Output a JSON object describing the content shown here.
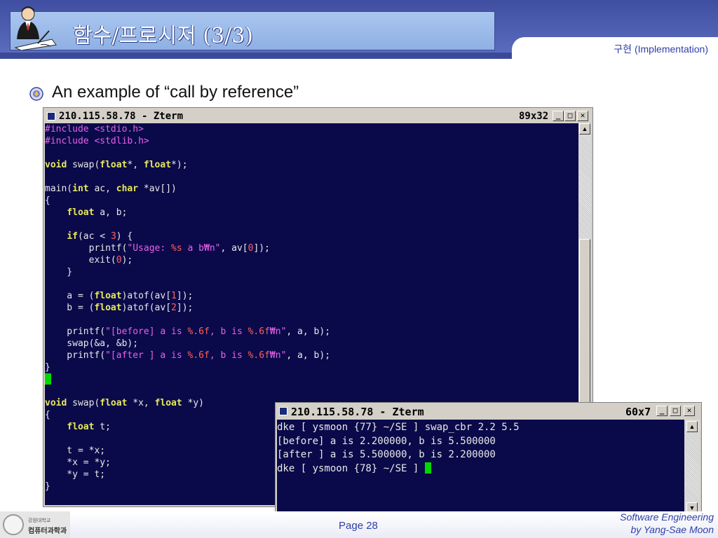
{
  "header": {
    "title": "함수/프로시저 (3/3)",
    "subtitle": "구현 (Implementation)"
  },
  "slide": {
    "bullet": "An example of “call by reference”"
  },
  "window_main": {
    "title": "210.115.58.78 - Zterm",
    "size": "89x32",
    "code_lines": [
      [
        {
          "c": "p",
          "t": "#include "
        },
        {
          "c": "p",
          "t": "<stdio.h>"
        }
      ],
      [
        {
          "c": "p",
          "t": "#include "
        },
        {
          "c": "p",
          "t": "<stdlib.h>"
        }
      ],
      [],
      [
        {
          "c": "k",
          "t": "void"
        },
        {
          "t": " swap("
        },
        {
          "c": "k",
          "t": "float"
        },
        {
          "t": "*, "
        },
        {
          "c": "k",
          "t": "float"
        },
        {
          "t": "*);"
        }
      ],
      [],
      [
        {
          "t": "main("
        },
        {
          "c": "k",
          "t": "int"
        },
        {
          "t": " ac, "
        },
        {
          "c": "k",
          "t": "char"
        },
        {
          "t": " *av[])"
        }
      ],
      [
        {
          "t": "{"
        }
      ],
      [
        {
          "t": "    "
        },
        {
          "c": "k",
          "t": "float"
        },
        {
          "t": " a, b;"
        }
      ],
      [],
      [
        {
          "t": "    "
        },
        {
          "c": "k",
          "t": "if"
        },
        {
          "t": "(ac < "
        },
        {
          "c": "n",
          "t": "3"
        },
        {
          "t": ") {"
        }
      ],
      [
        {
          "t": "        printf("
        },
        {
          "c": "s",
          "t": "\"Usage: "
        },
        {
          "c": "f",
          "t": "%s"
        },
        {
          "c": "s",
          "t": " a b₩n\""
        },
        {
          "t": ", av["
        },
        {
          "c": "n",
          "t": "0"
        },
        {
          "t": "]);"
        }
      ],
      [
        {
          "t": "        exit("
        },
        {
          "c": "n",
          "t": "0"
        },
        {
          "t": ");"
        }
      ],
      [
        {
          "t": "    }"
        }
      ],
      [],
      [
        {
          "t": "    a = ("
        },
        {
          "c": "k",
          "t": "float"
        },
        {
          "t": ")atof(av["
        },
        {
          "c": "n",
          "t": "1"
        },
        {
          "t": "]);"
        }
      ],
      [
        {
          "t": "    b = ("
        },
        {
          "c": "k",
          "t": "float"
        },
        {
          "t": ")atof(av["
        },
        {
          "c": "n",
          "t": "2"
        },
        {
          "t": "]);"
        }
      ],
      [],
      [
        {
          "t": "    printf("
        },
        {
          "c": "s",
          "t": "\"[before] a is "
        },
        {
          "c": "f",
          "t": "%.6f"
        },
        {
          "c": "s",
          "t": ", b is "
        },
        {
          "c": "f",
          "t": "%.6f"
        },
        {
          "c": "s",
          "t": "₩n\""
        },
        {
          "t": ", a, b);"
        }
      ],
      [
        {
          "t": "    swap(&a, &b);"
        }
      ],
      [
        {
          "t": "    printf("
        },
        {
          "c": "s",
          "t": "\"[after ] a is "
        },
        {
          "c": "f",
          "t": "%.6f"
        },
        {
          "c": "s",
          "t": ", b is "
        },
        {
          "c": "f",
          "t": "%.6f"
        },
        {
          "c": "s",
          "t": "₩n\""
        },
        {
          "t": ", a, b);"
        }
      ],
      [
        {
          "t": "}"
        }
      ],
      [
        {
          "cursor": true
        }
      ],
      [],
      [
        {
          "c": "k",
          "t": "void"
        },
        {
          "t": " swap("
        },
        {
          "c": "k",
          "t": "float"
        },
        {
          "t": " *x, "
        },
        {
          "c": "k",
          "t": "float"
        },
        {
          "t": " *y)"
        }
      ],
      [
        {
          "t": "{"
        }
      ],
      [
        {
          "t": "    "
        },
        {
          "c": "k",
          "t": "float"
        },
        {
          "t": " t;"
        }
      ],
      [],
      [
        {
          "t": "    t = *x;"
        }
      ],
      [
        {
          "t": "    *x = *y;"
        }
      ],
      [
        {
          "t": "    *y = t;"
        }
      ],
      [
        {
          "t": "}"
        }
      ]
    ]
  },
  "window_out": {
    "title": "210.115.58.78 - Zterm",
    "size": "60x7",
    "lines": [
      [
        {
          "t": "dke [ ysmoon {77} ~/SE ] swap_cbr 2.2 5.5"
        }
      ],
      [
        {
          "t": "[before] a is 2.200000, b is 5.500000"
        }
      ],
      [
        {
          "t": "[after ] a is 5.500000, b is 2.200000"
        }
      ],
      [
        {
          "t": "dke [ ysmoon {78} ~/SE ] "
        },
        {
          "cursor": true
        }
      ]
    ]
  },
  "footer": {
    "page": "Page 28",
    "course": "Software Engineering",
    "author": "by Yang-Sae Moon",
    "university_name": "강원대학교",
    "department": "컴퓨터과학과"
  }
}
